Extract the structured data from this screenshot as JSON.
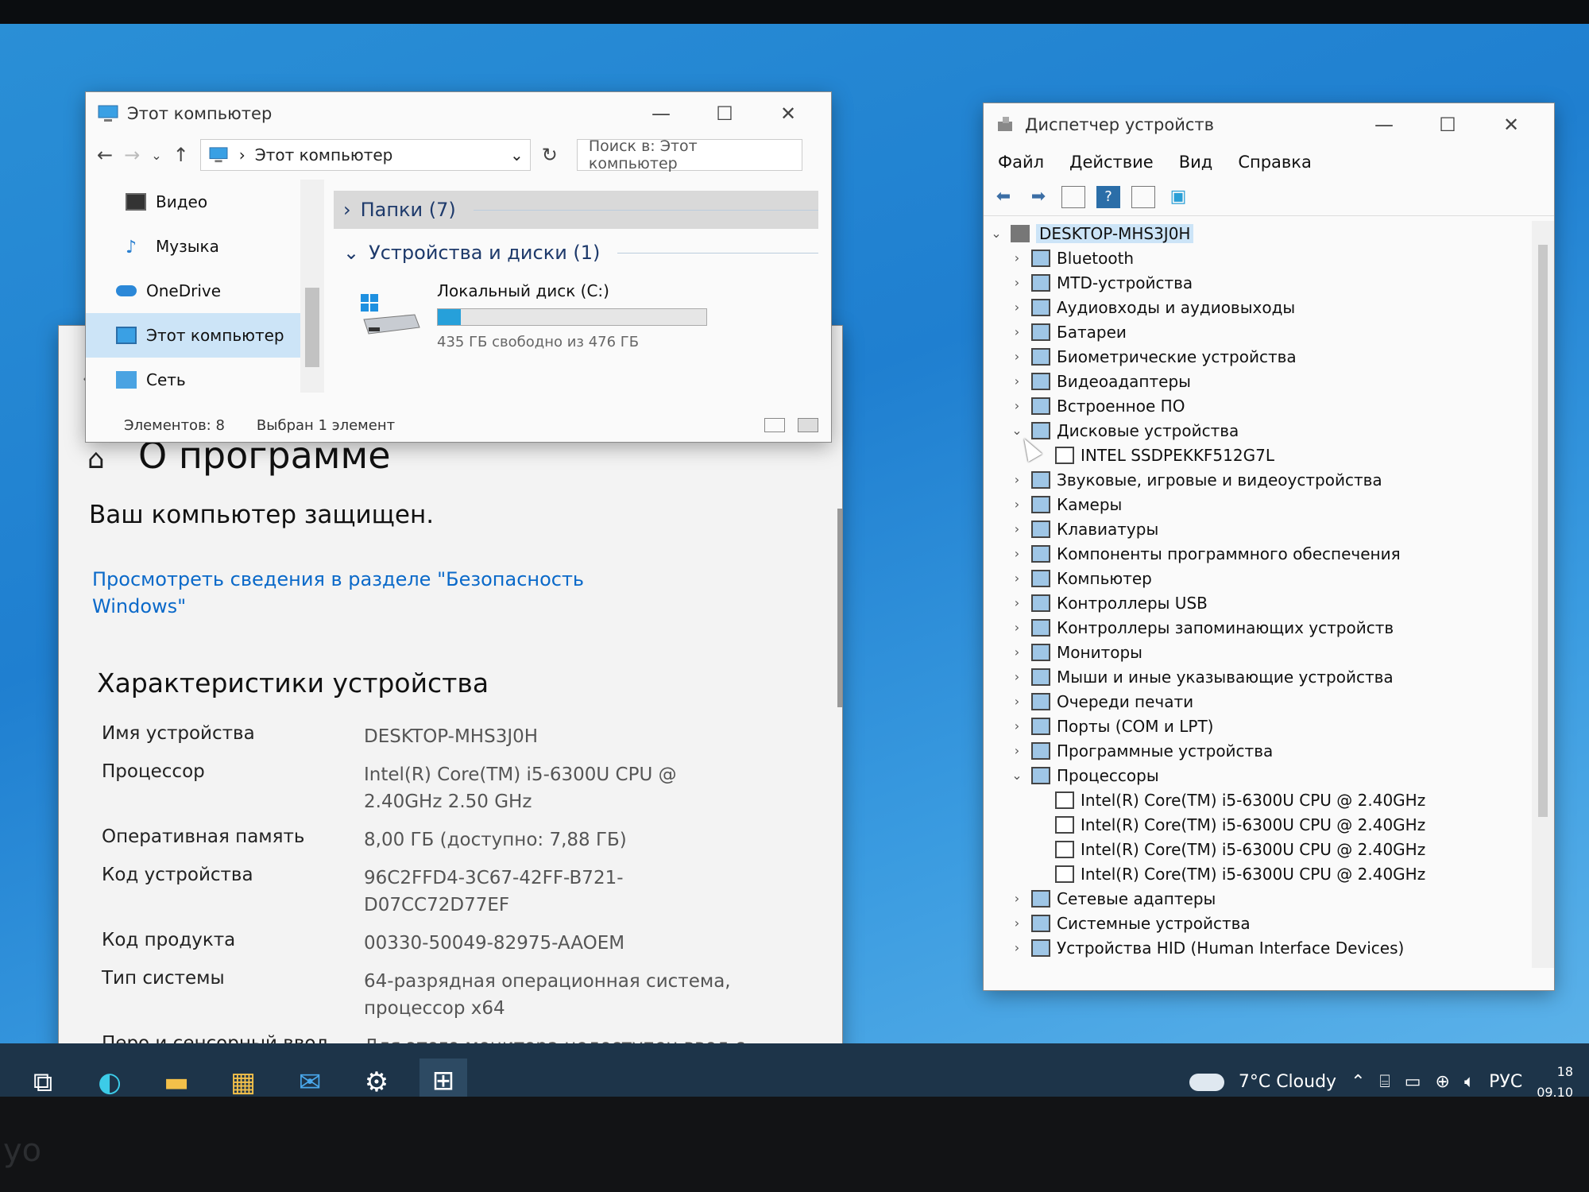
{
  "settings": {
    "title": "О программе",
    "protected": "Ваш компьютер защищен.",
    "security_link": "Просмотреть сведения в разделе \"Безопасность Windows\"",
    "specs_heading": "Характеристики устройства",
    "specs": [
      {
        "k": "Имя устройства",
        "v": "DESKTOP-MHS3J0H"
      },
      {
        "k": "Процессор",
        "v": "Intel(R) Core(TM) i5-6300U CPU @ 2.40GHz   2.50 GHz"
      },
      {
        "k": "Оперативная память",
        "v": "8,00 ГБ (доступно: 7,88 ГБ)"
      },
      {
        "k": "Код устройства",
        "v": "96C2FFD4-3C67-42FF-B721-D07CC72D77EF"
      },
      {
        "k": "Код продукта",
        "v": "00330-50049-82975-AAOEM"
      },
      {
        "k": "Тип системы",
        "v": "64-разрядная операционная система, процессор x64"
      },
      {
        "k": "Перо и сенсорный ввод",
        "v": "Для этого монитора недоступен ввод с помощью пера и сенсорный ввод"
      }
    ]
  },
  "explorer": {
    "title": "Этот компьютер",
    "address": "Этот компьютер",
    "search_placeholder": "Поиск в: Этот компьютер",
    "sidebar": [
      "Видео",
      "Музыка",
      "OneDrive",
      "Этот компьютер",
      "Сеть"
    ],
    "group_folders": "Папки (7)",
    "group_devices": "Устройства и диски (1)",
    "disk_name": "Локальный диск (C:)",
    "disk_free": "435 ГБ свободно из 476 ГБ",
    "disk_used_fraction": 0.086,
    "status_items": "Элементов: 8",
    "status_selected": "Выбран 1 элемент"
  },
  "devmgr": {
    "title": "Диспетчер устройств",
    "menu": [
      "Файл",
      "Действие",
      "Вид",
      "Справка"
    ],
    "root": "DESKTOP-MHS3J0H",
    "nodes": [
      {
        "label": "Bluetooth",
        "expanded": false,
        "level": 1
      },
      {
        "label": "MTD-устройства",
        "expanded": false,
        "level": 1
      },
      {
        "label": "Аудиовходы и аудиовыходы",
        "expanded": false,
        "level": 1
      },
      {
        "label": "Батареи",
        "expanded": false,
        "level": 1
      },
      {
        "label": "Биометрические устройства",
        "expanded": false,
        "level": 1
      },
      {
        "label": "Видеоадаптеры",
        "expanded": false,
        "level": 1
      },
      {
        "label": "Встроенное ПО",
        "expanded": false,
        "level": 1
      },
      {
        "label": "Дисковые устройства",
        "expanded": true,
        "level": 1
      },
      {
        "label": "INTEL SSDPEKKF512G7L",
        "level": 2
      },
      {
        "label": "Звуковые, игровые и видеоустройства",
        "expanded": false,
        "level": 1
      },
      {
        "label": "Камеры",
        "expanded": false,
        "level": 1
      },
      {
        "label": "Клавиатуры",
        "expanded": false,
        "level": 1
      },
      {
        "label": "Компоненты программного обеспечения",
        "expanded": false,
        "level": 1
      },
      {
        "label": "Компьютер",
        "expanded": false,
        "level": 1
      },
      {
        "label": "Контроллеры USB",
        "expanded": false,
        "level": 1
      },
      {
        "label": "Контроллеры запоминающих устройств",
        "expanded": false,
        "level": 1
      },
      {
        "label": "Мониторы",
        "expanded": false,
        "level": 1
      },
      {
        "label": "Мыши и иные указывающие устройства",
        "expanded": false,
        "level": 1
      },
      {
        "label": "Очереди печати",
        "expanded": false,
        "level": 1
      },
      {
        "label": "Порты (COM и LPT)",
        "expanded": false,
        "level": 1
      },
      {
        "label": "Программные устройства",
        "expanded": false,
        "level": 1
      },
      {
        "label": "Процессоры",
        "expanded": true,
        "level": 1
      },
      {
        "label": "Intel(R) Core(TM) i5-6300U CPU @ 2.40GHz",
        "level": 2
      },
      {
        "label": "Intel(R) Core(TM) i5-6300U CPU @ 2.40GHz",
        "level": 2
      },
      {
        "label": "Intel(R) Core(TM) i5-6300U CPU @ 2.40GHz",
        "level": 2
      },
      {
        "label": "Intel(R) Core(TM) i5-6300U CPU @ 2.40GHz",
        "level": 2
      },
      {
        "label": "Сетевые адаптеры",
        "expanded": false,
        "level": 1
      },
      {
        "label": "Системные устройства",
        "expanded": false,
        "level": 1
      },
      {
        "label": "Устройства HID (Human Interface Devices)",
        "expanded": false,
        "level": 1
      }
    ]
  },
  "taskbar": {
    "weather": "7°C  Cloudy",
    "lang": "РУС",
    "time": "18",
    "date": "09.10",
    "icons": [
      "task-view-icon",
      "edge-icon",
      "file-explorer-icon",
      "store-icon",
      "mail-icon",
      "settings-icon",
      "device-manager-icon"
    ]
  },
  "colors": {
    "accent": "#0078d4",
    "link": "#0a69c9",
    "taskbar": "#1d3449",
    "selection": "#cce4f7"
  }
}
